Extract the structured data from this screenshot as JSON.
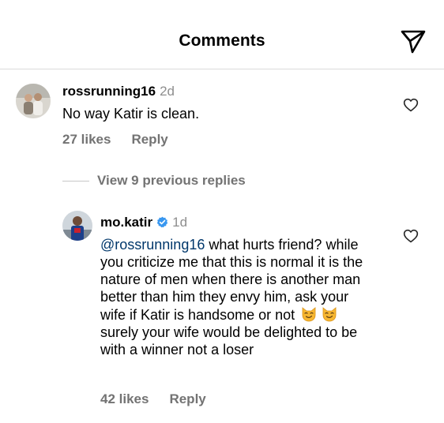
{
  "header": {
    "title": "Comments"
  },
  "comment1": {
    "username": "rossrunning16",
    "time": "2d",
    "text": "No way Katir is clean.",
    "likes": "27 likes",
    "reply_label": "Reply"
  },
  "view_replies": {
    "label": "View 9 previous replies"
  },
  "comment2": {
    "username": "mo.katir",
    "time": "1d",
    "mention": "@rossrunning16",
    "text_part1": " what hurts friend? while you criticize me that this is normal it is the nature of men when there is another man better than him they envy him, ask your wife if Katir is handsome or not",
    "text_part2": " surely your wife would be delighted to be with a winner not a loser",
    "emojis": [
      "cat-smirk-emoji",
      "cat-smirk-emoji"
    ],
    "likes": "42 likes",
    "reply_label": "Reply"
  },
  "icons": {
    "send": "paper-plane-icon",
    "like": "heart-outline-icon",
    "verified": "verified-badge-icon"
  },
  "colors": {
    "verified": "#3897f0",
    "meta_text": "#737373",
    "mention": "#00376b"
  }
}
